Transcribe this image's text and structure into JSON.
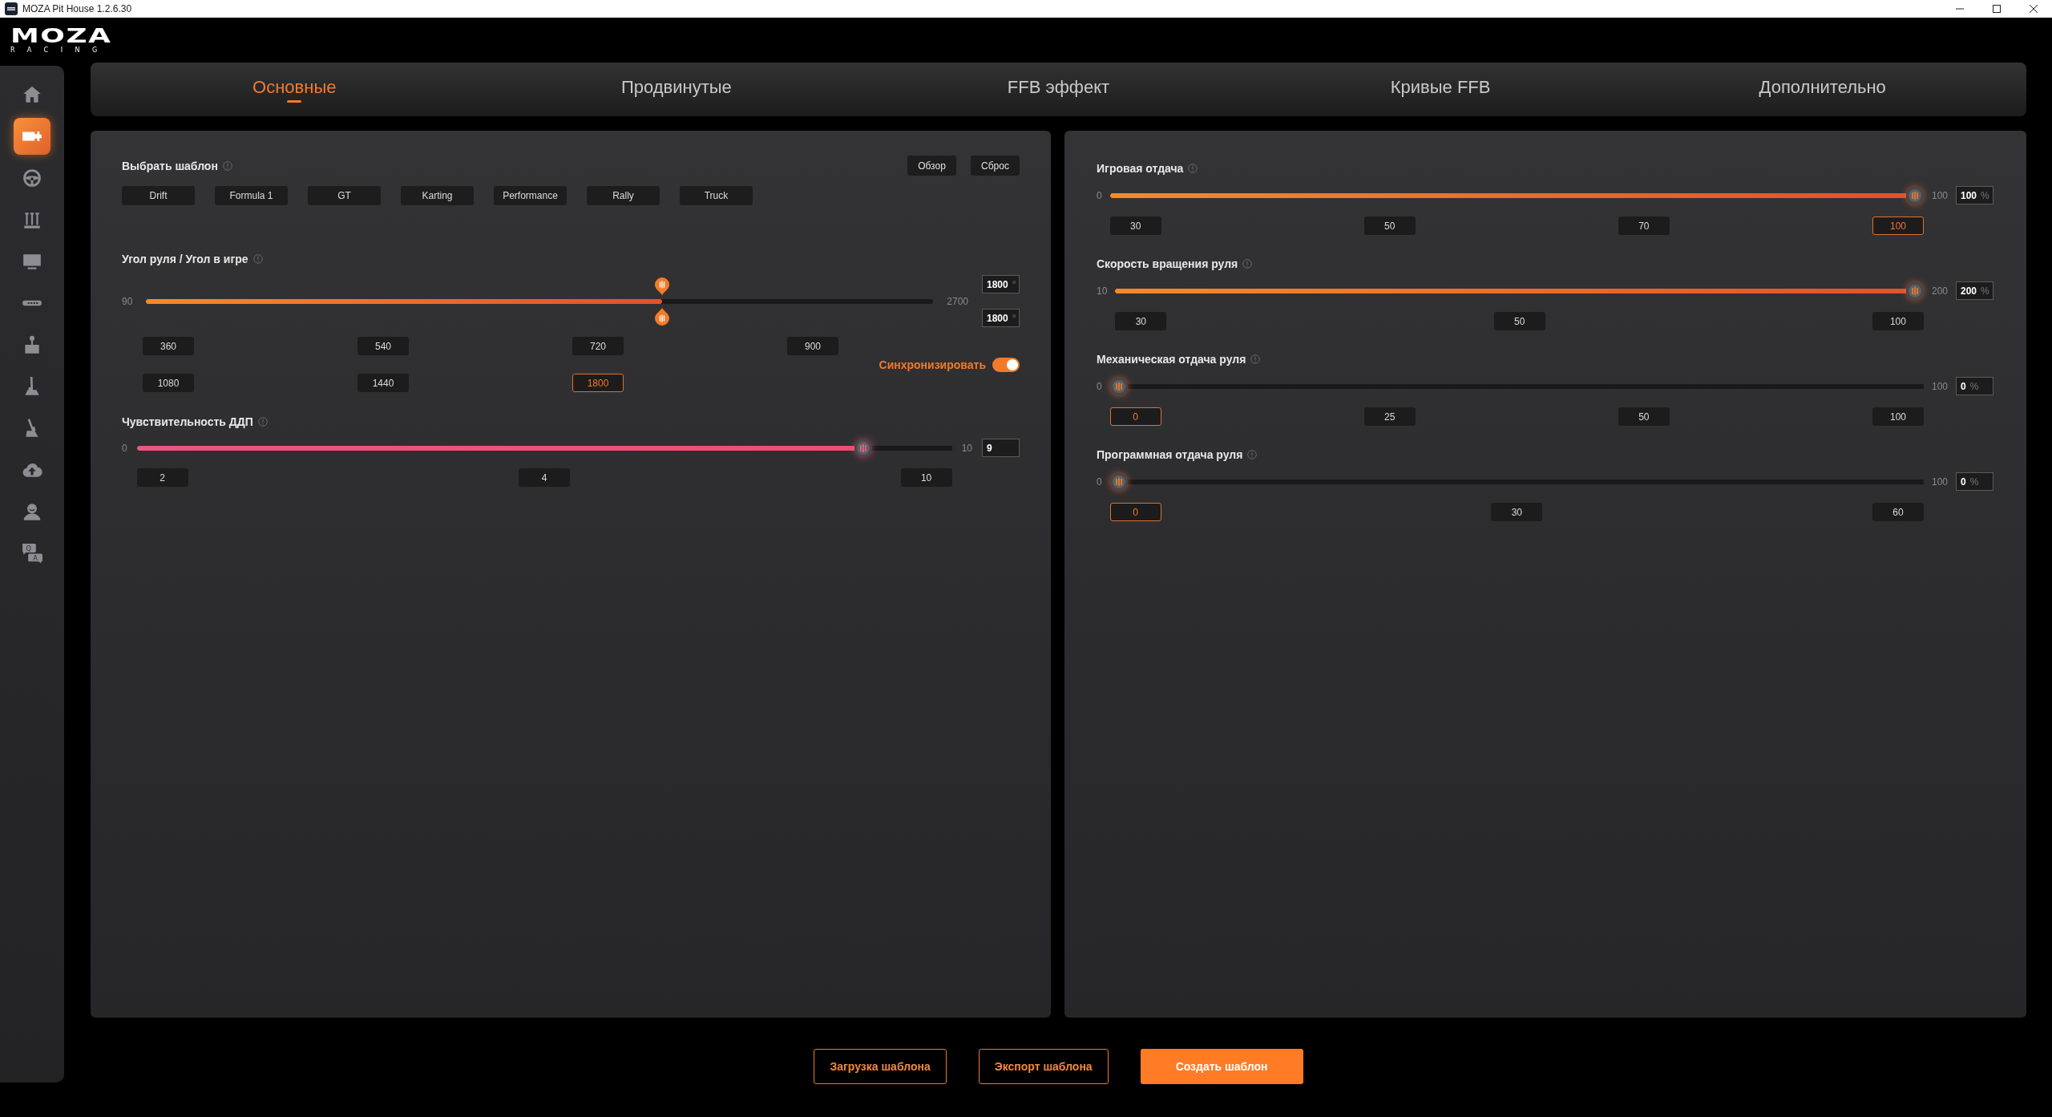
{
  "window": {
    "title": "MOZA Pit House 1.2.6.30"
  },
  "logo": {
    "wordmark": "MOZA",
    "tagline": "RACING"
  },
  "sidebar": {
    "items": [
      {
        "kind": "home",
        "selected": false
      },
      {
        "kind": "wheelbase",
        "selected": true
      },
      {
        "kind": "wheel",
        "selected": false
      },
      {
        "kind": "pedals",
        "selected": false
      },
      {
        "kind": "dashboard",
        "selected": false
      },
      {
        "kind": "ledbar",
        "selected": false
      },
      {
        "kind": "buttonbox",
        "selected": false
      },
      {
        "kind": "shifter",
        "selected": false
      },
      {
        "kind": "handbrake",
        "selected": false
      },
      {
        "kind": "cloud",
        "selected": false
      },
      {
        "kind": "account",
        "selected": false
      },
      {
        "kind": "faq",
        "selected": false,
        "letters": [
          "Q",
          "A"
        ]
      }
    ]
  },
  "tabs": [
    {
      "label": "Основные",
      "selected": true
    },
    {
      "label": "Продвинутые",
      "selected": false
    },
    {
      "label": "FFB эффект",
      "selected": false
    },
    {
      "label": "Кривые FFB",
      "selected": false
    },
    {
      "label": "Дополнительно",
      "selected": false
    }
  ],
  "left_panel": {
    "template": {
      "label": "Выбрать шаблон",
      "actions": [
        "Обзор",
        "Сброс"
      ],
      "presets": [
        "Drift",
        "Formula 1",
        "GT",
        "Karting",
        "Performance",
        "Rally",
        "Truck"
      ]
    },
    "steering_angle": {
      "label": "Угол руля / Угол в игре",
      "min": "90",
      "max": "2700",
      "handles": [
        {
          "level": 0.655,
          "value": "1800",
          "unit": "°"
        },
        {
          "level": 0.655,
          "value": "1800",
          "unit": "°"
        }
      ],
      "presets": [
        {
          "label": "360",
          "selected": false
        },
        {
          "label": "540",
          "selected": false
        },
        {
          "label": "720",
          "selected": false
        },
        {
          "label": "900",
          "selected": false
        },
        {
          "label": "1080",
          "selected": false
        },
        {
          "label": "1440",
          "selected": false
        },
        {
          "label": "1800",
          "selected": true
        }
      ],
      "sync": {
        "label": "Синхронизировать",
        "on": true
      }
    },
    "sensitivity": {
      "label": "Чувствительность ДДП",
      "min": "0",
      "max": "10",
      "level": 0.9,
      "value": "9",
      "presets": [
        {
          "label": "2",
          "selected": false
        },
        {
          "label": "4",
          "selected": false
        },
        {
          "label": "10",
          "selected": false
        }
      ]
    }
  },
  "right_panel": {
    "sliders": [
      {
        "label": "Игровая отдача",
        "min": "0",
        "max": "100",
        "level": 1,
        "value": "100",
        "unit": "%",
        "presets": [
          {
            "label": "30",
            "selected": false
          },
          {
            "label": "50",
            "selected": false
          },
          {
            "label": "70",
            "selected": false
          },
          {
            "label": "100",
            "selected": true
          }
        ]
      },
      {
        "label": "Скорость вращения руля",
        "min": "10",
        "max": "200",
        "level": 1,
        "value": "200",
        "unit": "%",
        "presets": [
          {
            "label": "30",
            "selected": false
          },
          {
            "label": "50",
            "selected": false
          },
          {
            "label": "100",
            "selected": false
          }
        ]
      },
      {
        "label": "Механическая отдача руля",
        "min": "0",
        "max": "100",
        "level": 0,
        "value": "0",
        "unit": "%",
        "presets": [
          {
            "label": "0",
            "selected": true
          },
          {
            "label": "25",
            "selected": false
          },
          {
            "label": "50",
            "selected": false
          },
          {
            "label": "100",
            "selected": false
          }
        ]
      },
      {
        "label": "Программная отдача руля",
        "min": "0",
        "max": "100",
        "level": 0,
        "value": "0",
        "unit": "%",
        "presets": [
          {
            "label": "0",
            "selected": true
          },
          {
            "label": "30",
            "selected": false
          },
          {
            "label": "60",
            "selected": false
          }
        ]
      }
    ]
  },
  "actions": [
    {
      "label": "Загрузка шаблона",
      "kind": "outline"
    },
    {
      "label": "Экспорт шаблона",
      "kind": "outline"
    },
    {
      "label": "Создать шаблон",
      "kind": "primary"
    }
  ]
}
